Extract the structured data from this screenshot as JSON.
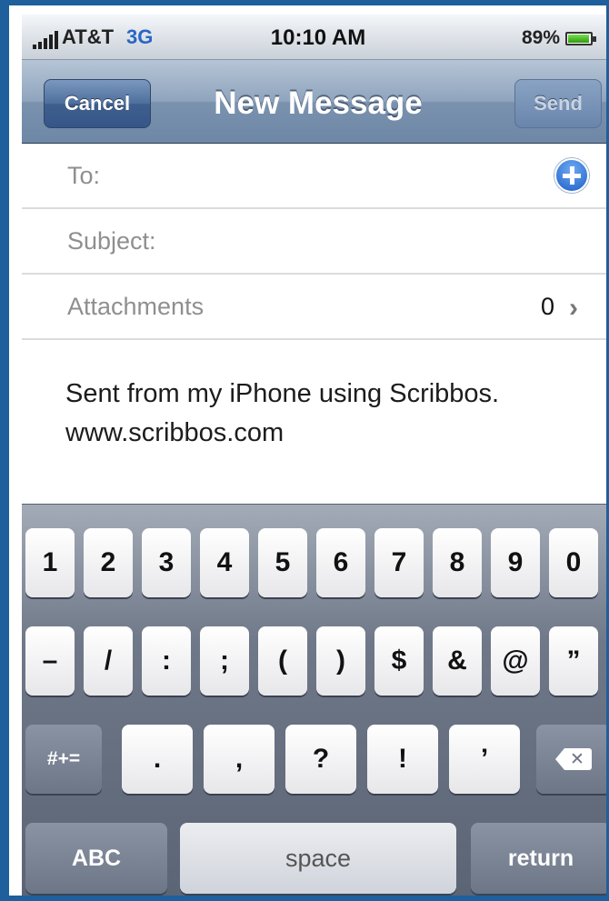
{
  "status_bar": {
    "carrier": "AT&T",
    "network": "3G",
    "time": "10:10 AM",
    "battery_percent": "89%",
    "battery_level": 0.89
  },
  "nav": {
    "cancel_label": "Cancel",
    "title": "New Message",
    "send_label": "Send"
  },
  "fields": {
    "to_label": "To:",
    "subject_label": "Subject:",
    "attachments_label": "Attachments",
    "attachments_count": "0"
  },
  "body": {
    "line1": "Sent from my iPhone using Scribbos.",
    "line2": "www.scribbos.com"
  },
  "keyboard": {
    "row1": [
      "1",
      "2",
      "3",
      "4",
      "5",
      "6",
      "7",
      "8",
      "9",
      "0"
    ],
    "row2": [
      "–",
      "/",
      ":",
      ";",
      "(",
      ")",
      "$",
      "&",
      "@",
      "”"
    ],
    "row3": [
      "#+=",
      ".",
      ",",
      "?",
      "!",
      "’"
    ],
    "abc": "ABC",
    "space": "space",
    "return": "return"
  },
  "colors": {
    "frame": "#1e5f9c",
    "nav_bar": "#7a92ae",
    "keyboard": "#6f7888",
    "add_icon": "#1f5fc8"
  },
  "icons": {
    "add": "add-contact-icon",
    "chevron": "chevron-right-icon",
    "delete": "backspace-icon"
  }
}
